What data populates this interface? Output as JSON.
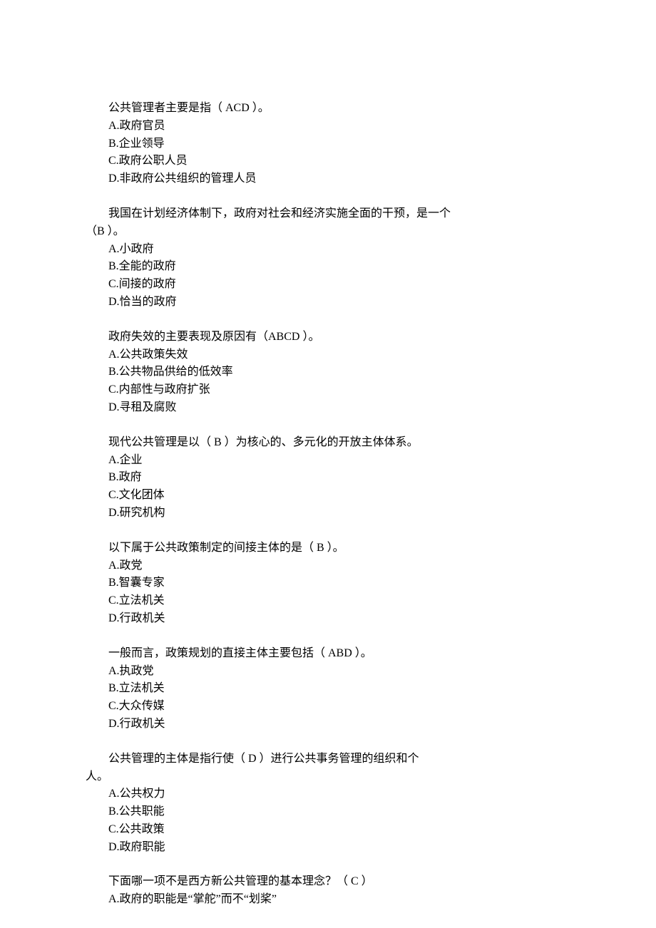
{
  "questions": [
    {
      "stem_lines": [
        "公共管理者主要是指（   ACD          ）。"
      ],
      "options": [
        "A.政府官员",
        "B.企业领导",
        "C.政府公职人员",
        "D.非政府公共组织的管理人员"
      ]
    },
    {
      "stem_lines": [
        "我国在计划经济体制下，政府对社会和经济实施全面的干预，是一个",
        "（B        ）。"
      ],
      "options": [
        "A.小政府",
        "B.全能的政府",
        "C.间接的政府",
        "D.恰当的政府"
      ]
    },
    {
      "stem_lines": [
        "政府失效的主要表现及原因有（ABCD                 ）。"
      ],
      "options": [
        "A.公共政策失效",
        "B.公共物品供给的低效率",
        "C.内部性与政府扩张",
        "D.寻租及腐败"
      ]
    },
    {
      "stem_lines": [
        "现代公共管理是以（     B     ）为核心的、多元化的开放主体体系。"
      ],
      "options": [
        "A.企业",
        "B.政府",
        "C.文化团体",
        "D.研究机构"
      ]
    },
    {
      "stem_lines": [
        "以下属于公共政策制定的间接主体的是（         B         ）。"
      ],
      "options": [
        "A.政党",
        "B.智囊专家",
        "C.立法机关",
        "D.行政机关"
      ]
    },
    {
      "stem_lines": [
        "一般而言，政策规划的直接主体主要包括（   ABD            ）。"
      ],
      "options": [
        "A.执政党",
        "B.立法机关",
        "C.大众传媒",
        "D.行政机关"
      ]
    },
    {
      "stem_lines": [
        "公共管理的主体是指行使（    D        ）进行公共事务管理的组织和个",
        "人。"
      ],
      "options": [
        "A.公共权力",
        "B.公共职能",
        "C.公共政策",
        "D.政府职能"
      ]
    },
    {
      "stem_lines": [
        "下面哪一项不是西方新公共管理的基本理念？（       C          ）"
      ],
      "options": [
        "A.政府的职能是“掌舵”而不“划桨”"
      ]
    }
  ]
}
